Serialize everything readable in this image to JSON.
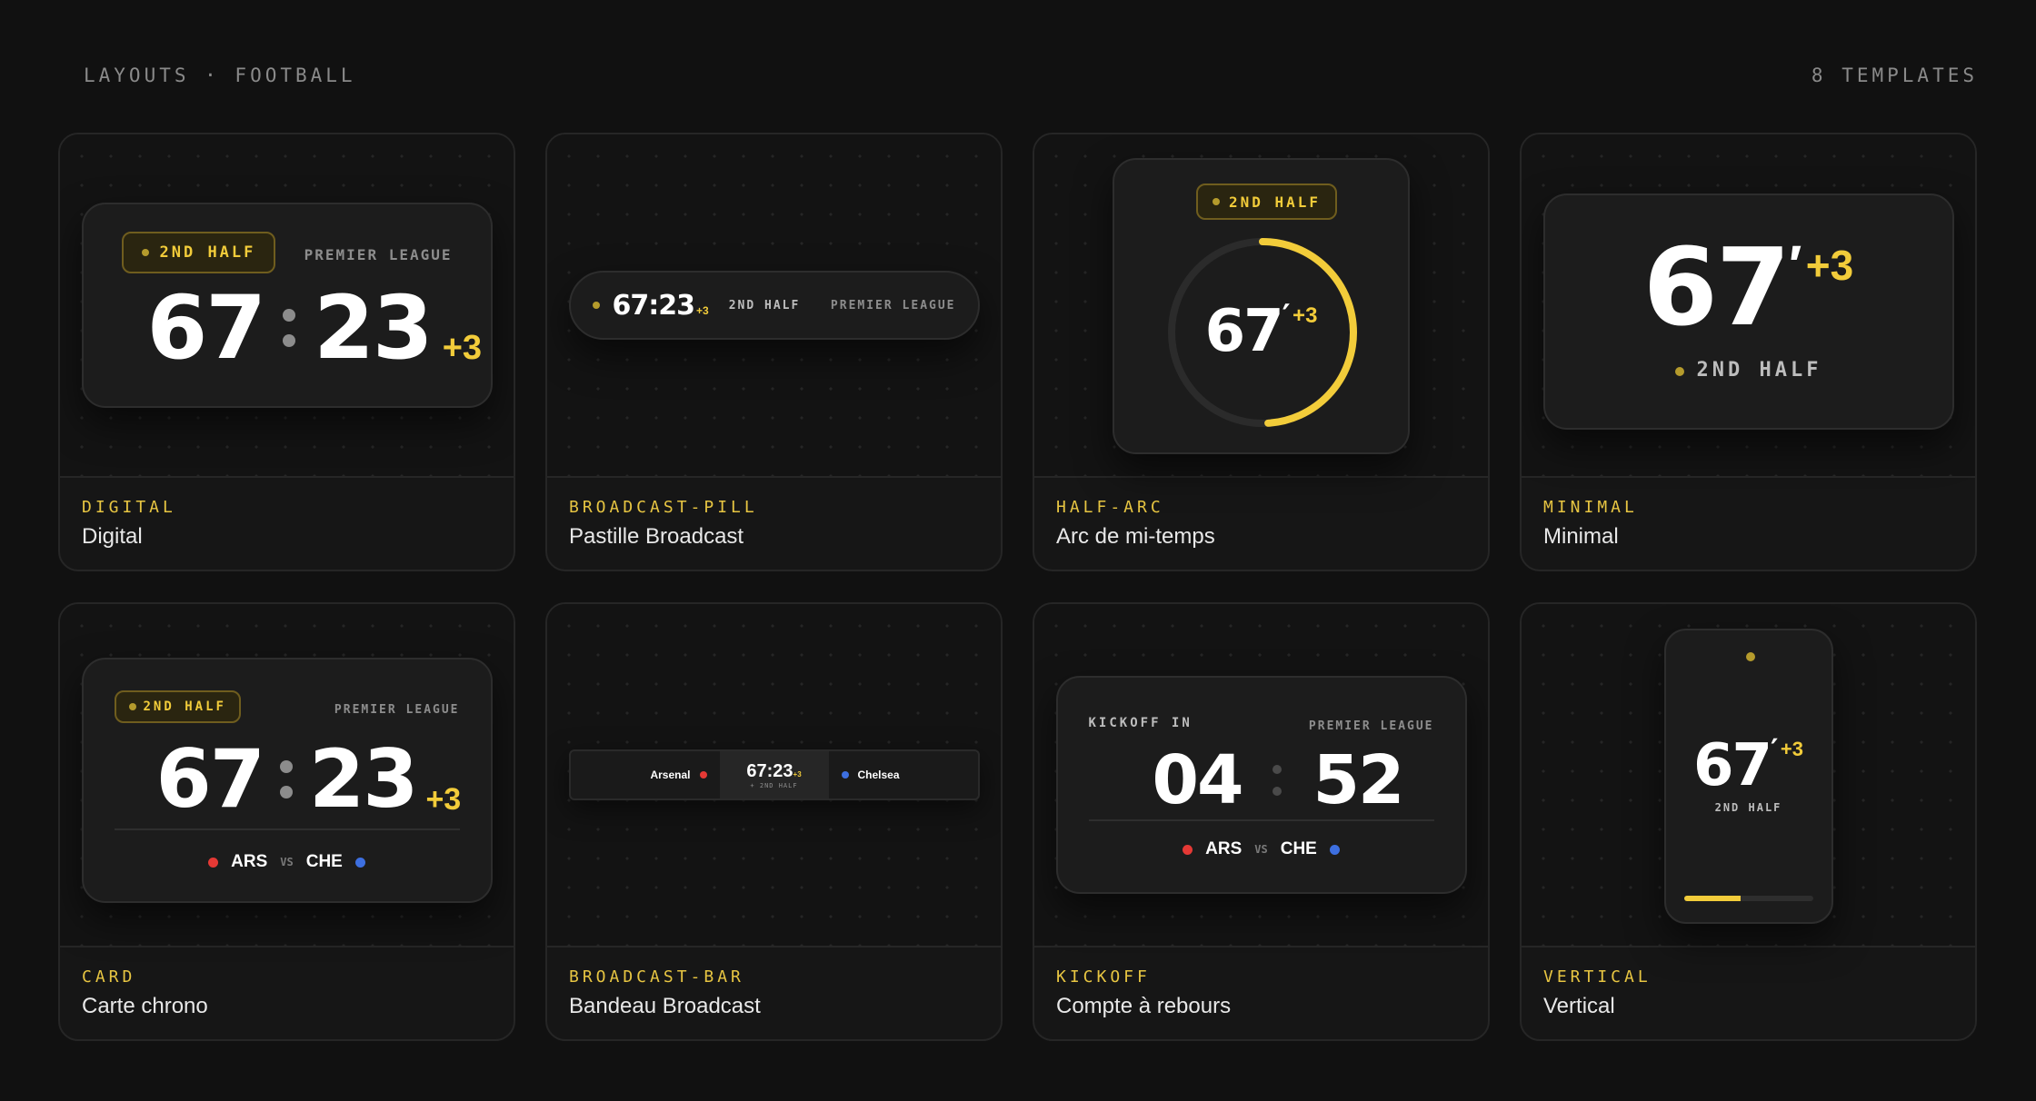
{
  "header": {
    "breadcrumb": "LAYOUTS · FOOTBALL",
    "count": "8 TEMPLATES"
  },
  "colors": {
    "accent": "#f2cc3a",
    "home": "#e53935",
    "away": "#3d6fe0",
    "background": "#111111"
  },
  "templates": [
    {
      "tag": "DIGITAL",
      "title": "Digital",
      "half": "2ND HALF",
      "league": "PREMIER LEAGUE",
      "min": "67",
      "sec": "23",
      "plus": "+3"
    },
    {
      "tag": "BROADCAST-PILL",
      "title": "Pastille Broadcast",
      "time": "67:23",
      "plus": "+3",
      "half": "2ND HALF",
      "league": "PREMIER LEAGUE"
    },
    {
      "tag": "HALF-ARC",
      "title": "Arc de mi-temps",
      "half": "2ND HALF",
      "min": "67",
      "prime": "′",
      "plus": "+3",
      "progress": 0.49
    },
    {
      "tag": "MINIMAL",
      "title": "Minimal",
      "min": "67",
      "prime": "′",
      "plus": "+3",
      "half": "2ND HALF"
    },
    {
      "tag": "CARD",
      "title": "Carte chrono",
      "half": "2ND HALF",
      "league": "PREMIER LEAGUE",
      "min": "67",
      "sec": "23",
      "plus": "+3",
      "home": "ARS",
      "vs": "VS",
      "away": "CHE"
    },
    {
      "tag": "BROADCAST-BAR",
      "title": "Bandeau Broadcast",
      "home": "Arsenal",
      "away": "Chelsea",
      "time": "67:23",
      "plus": "+3",
      "half": "+ 2ND HALF"
    },
    {
      "tag": "KICKOFF",
      "title": "Compte à rebours",
      "label": "KICKOFF IN",
      "league": "PREMIER LEAGUE",
      "min": "04",
      "sec": "52",
      "home": "ARS",
      "vs": "VS",
      "away": "CHE"
    },
    {
      "tag": "VERTICAL",
      "title": "Vertical",
      "min": "67",
      "prime": "′",
      "plus": "+3",
      "half": "2ND HALF",
      "progress": 0.44
    }
  ]
}
